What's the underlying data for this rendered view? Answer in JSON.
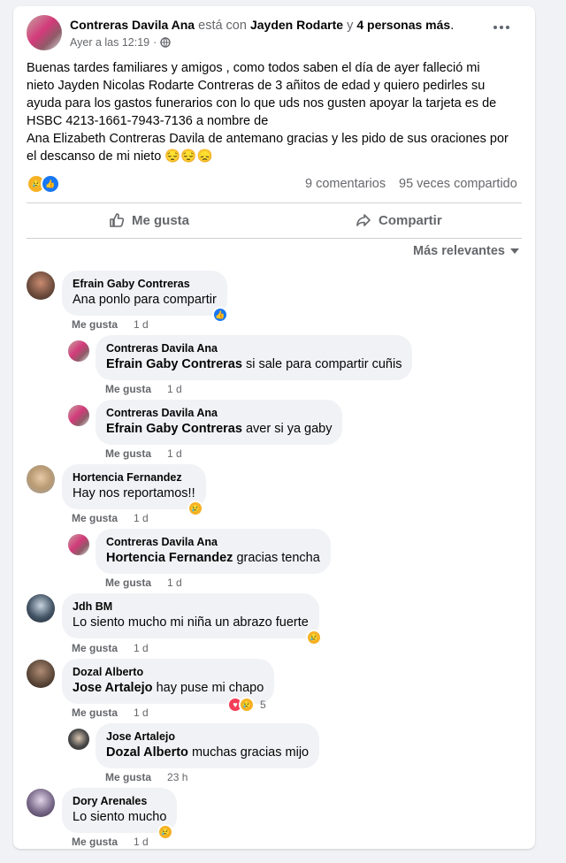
{
  "post": {
    "author": "Contreras Davila Ana",
    "with_text": "está con",
    "tagged": "Jayden Rodarte",
    "and_text": "y",
    "others": "4 personas más",
    "period": ".",
    "time": "Ayer a las 12:19",
    "dot": "·",
    "body_lines": [
      "Buenas tardes familiares y amigos , como todos saben el día de ayer falleció mi",
      "nieto Jayden Nicolas Rodarte Contreras de 3 añitos de edad y quiero pedirles su",
      "ayuda para los gastos funerarios con lo que uds nos gusten apoyar la tarjeta es de",
      "HSBC 4213-1661-7943-7136 a nombre de",
      "Ana Elizabeth Contreras Davila de antemano gracias y les pido de sus oraciones por",
      "el descanso de mi nieto 😔😔😞"
    ],
    "comments_count": "9 comentarios",
    "shares_count": "95 veces compartido",
    "like_label": "Me gusta",
    "share_label": "Compartir",
    "sort_label": "Más relevantes"
  },
  "comments": [
    {
      "author": "Efrain Gaby Contreras",
      "tag": "",
      "text": "Ana ponlo para compartir",
      "like": "Me gusta",
      "time": "1 d"
    },
    {
      "author": "Contreras Davila Ana",
      "tag": "Efrain Gaby Contreras",
      "text": "si sale para compartir cuñis",
      "like": "Me gusta",
      "time": "1 d"
    },
    {
      "author": "Contreras Davila Ana",
      "tag": "Efrain Gaby Contreras",
      "text": "aver si ya gaby",
      "like": "Me gusta",
      "time": "1 d"
    },
    {
      "author": "Hortencia Fernandez",
      "tag": "",
      "text": "Hay nos reportamos!!",
      "like": "Me gusta",
      "time": "1 d"
    },
    {
      "author": "Contreras Davila Ana",
      "tag": "Hortencia Fernandez",
      "text": "gracias tencha",
      "like": "Me gusta",
      "time": "1 d"
    },
    {
      "author": "Jdh BM",
      "tag": "",
      "text": "Lo siento mucho mi niña un abrazo fuerte",
      "like": "Me gusta",
      "time": "1 d"
    },
    {
      "author": "Dozal Alberto",
      "tag": "Jose Artalejo",
      "text": "hay puse mi chapo",
      "like": "Me gusta",
      "time": "1 d",
      "reaction_count": "5"
    },
    {
      "author": "Jose Artalejo",
      "tag": "Dozal Alberto",
      "text": "muchas gracias mijo",
      "like": "Me gusta",
      "time": "23 h"
    },
    {
      "author": "Dory Arenales",
      "tag": "",
      "text": "Lo siento mucho",
      "like": "Me gusta",
      "time": "1 d"
    }
  ],
  "icons": {
    "more": "more-icon",
    "globe": "globe-icon",
    "like": "thumbs-up-icon",
    "share": "share-arrow-icon",
    "sort": "caret-down-icon"
  },
  "colors": {
    "like_blue": "#1877f2",
    "sad_yellow": "#f7b125",
    "heart_red": "#f33e58",
    "muted": "#65676b"
  }
}
